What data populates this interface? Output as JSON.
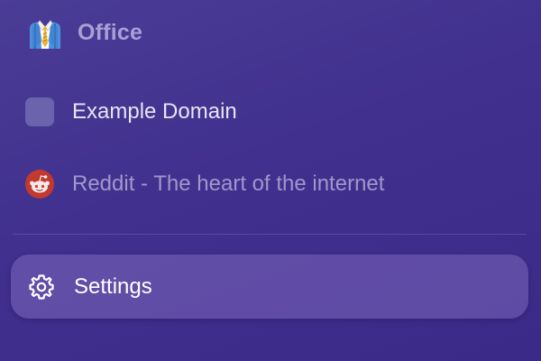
{
  "section": {
    "title": "Office",
    "icon": "office-worker-icon"
  },
  "items": [
    {
      "label": "Example Domain",
      "icon": "generic-favicon-icon"
    },
    {
      "label": "Reddit - The heart of the internet",
      "icon": "reddit-icon"
    }
  ],
  "settings": {
    "label": "Settings",
    "icon": "gear-icon"
  },
  "colors": {
    "background": "#41308e",
    "highlight": "#6a5aa8",
    "reddit": "#d93a1e"
  }
}
